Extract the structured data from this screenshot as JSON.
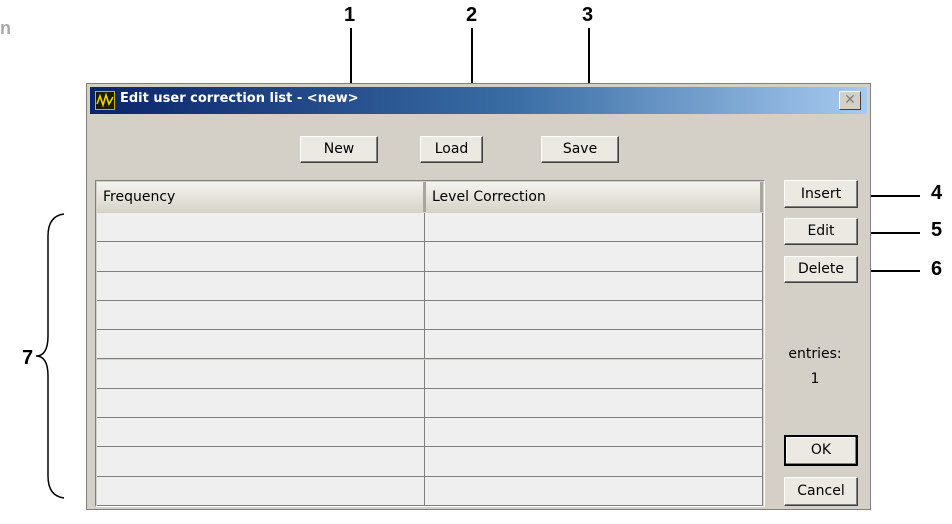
{
  "corner_text": "n",
  "callouts": [
    "1",
    "2",
    "3",
    "4",
    "5",
    "6",
    "7"
  ],
  "dialog": {
    "title": "Edit user correction list - <new>",
    "close_glyph": "✕",
    "toolbar": {
      "new": "New",
      "load": "Load",
      "save": "Save"
    },
    "table": {
      "columns": [
        "Frequency",
        "Level Correction"
      ],
      "rows": 10
    },
    "side": {
      "insert": "Insert",
      "edit": "Edit",
      "delete": "Delete"
    },
    "entries_label": "entries:",
    "entries_value": "1",
    "ok": "OK",
    "cancel": "Cancel"
  },
  "colors": {
    "title_start": "#0a246a",
    "title_end": "#a6caf0",
    "face": "#d4d0c8",
    "cell": "#efefef"
  }
}
